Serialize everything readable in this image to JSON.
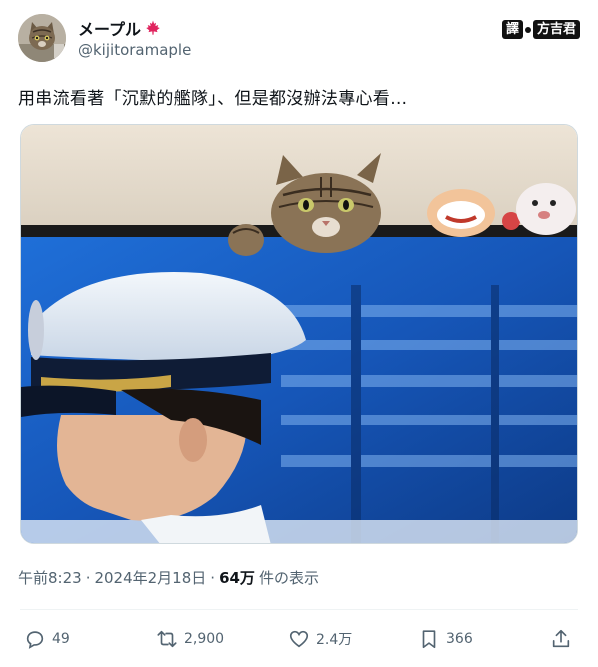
{
  "author": {
    "display_name": "メープル",
    "handle": "@kijitoramaple",
    "avatar_icon": "cat-avatar-icon",
    "flag_icon": "maple-leaf-icon"
  },
  "translator": {
    "label_left": "譯",
    "label_right": "方吉君"
  },
  "tweet": {
    "text": "用串流看著「沉默的艦隊」、但是都沒辦法專心看…",
    "media_description_icon": "cat-over-tv-photo"
  },
  "meta": {
    "time": "午前8:23",
    "separator": "·",
    "date": "2024年2月18日",
    "views_count": "64万",
    "views_label": "件の表示"
  },
  "actions": {
    "reply_count": "49",
    "retweet_count": "2,900",
    "like_count": "2.4万",
    "bookmark_count": "366"
  },
  "colors": {
    "text_primary": "#0f1419",
    "text_secondary": "#536471",
    "divider": "#eff3f4",
    "maple_red": "#e0245e"
  }
}
